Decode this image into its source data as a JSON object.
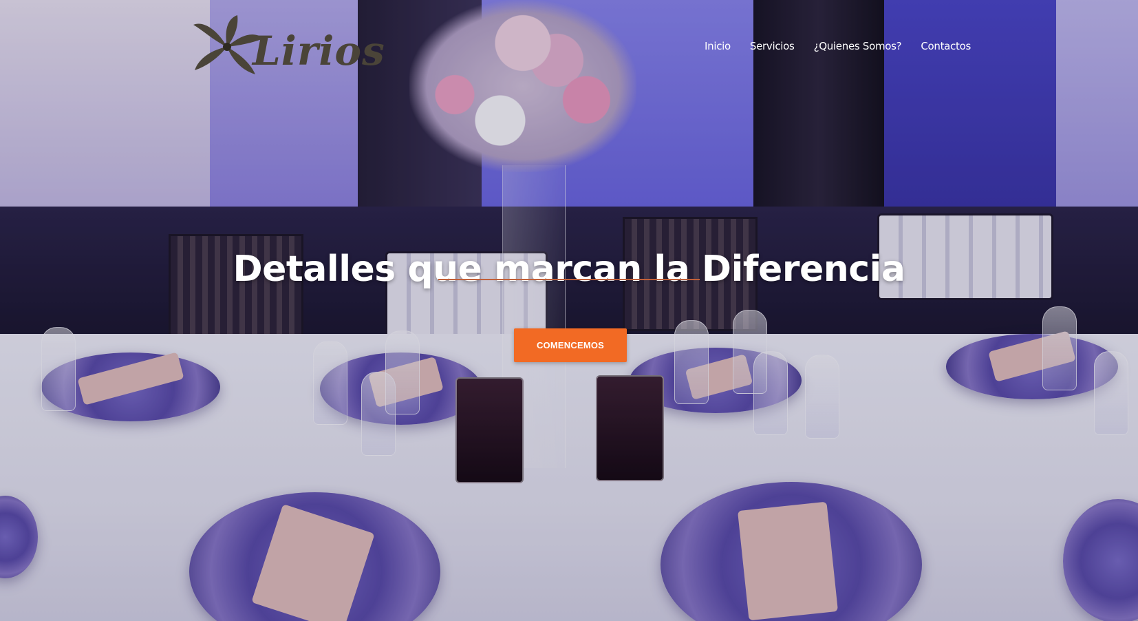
{
  "brand": {
    "logo_text": "Lirios",
    "logo_icon": "lily-flower-icon",
    "logo_color": "#4a4438"
  },
  "nav": {
    "items": [
      {
        "label": "Inicio"
      },
      {
        "label": "Servicios"
      },
      {
        "label": "¿Quienes Somos?"
      },
      {
        "label": "Contactos"
      }
    ]
  },
  "hero": {
    "headline": "Detalles que marcan la Diferencia",
    "cta_label": "COMENCEMOS",
    "accent_color": "#f26a24",
    "divider_color": "#c1613a",
    "background_image": "banquet-table-setting-photo"
  }
}
